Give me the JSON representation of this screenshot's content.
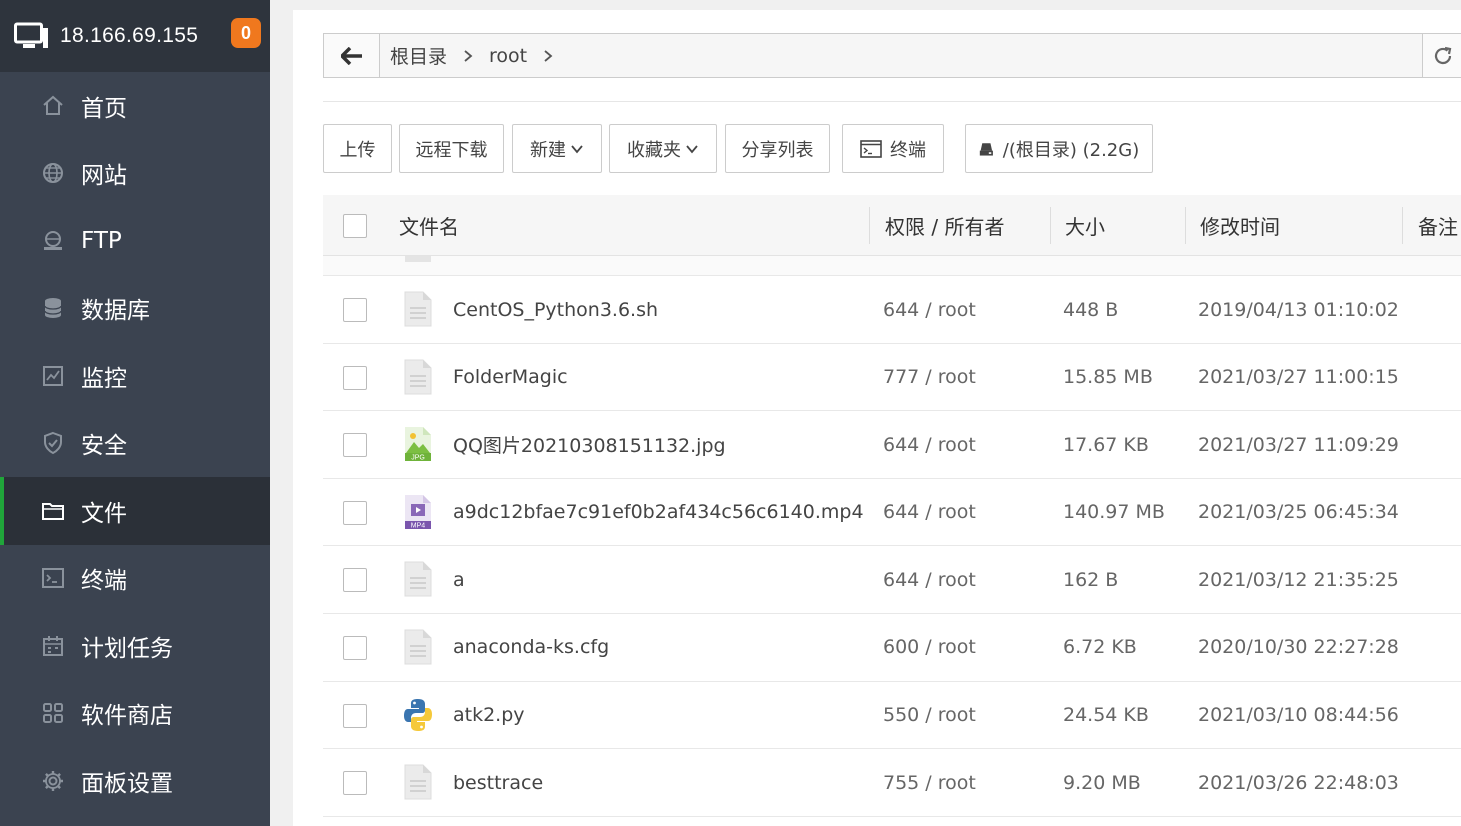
{
  "server": {
    "ip": "18.166.69.155",
    "badge": "0"
  },
  "nav": [
    {
      "label": "首页",
      "icon": "home-icon"
    },
    {
      "label": "网站",
      "icon": "globe-icon"
    },
    {
      "label": "FTP",
      "icon": "ftp-icon"
    },
    {
      "label": "数据库",
      "icon": "database-icon"
    },
    {
      "label": "监控",
      "icon": "monitor-chart-icon"
    },
    {
      "label": "安全",
      "icon": "shield-icon"
    },
    {
      "label": "文件",
      "icon": "folder-icon",
      "active": true
    },
    {
      "label": "终端",
      "icon": "terminal-icon"
    },
    {
      "label": "计划任务",
      "icon": "calendar-icon"
    },
    {
      "label": "软件商店",
      "icon": "apps-grid-icon"
    },
    {
      "label": "面板设置",
      "icon": "gear-icon"
    }
  ],
  "path": {
    "crumbs": [
      "根目录",
      "root"
    ]
  },
  "toolbar": {
    "upload": "上传",
    "remote_download": "远程下载",
    "new": "新建",
    "favorites": "收藏夹",
    "share_list": "分享列表",
    "terminal": "终端",
    "disk": "/(根目录) (2.2G)"
  },
  "table": {
    "headers": {
      "name": "文件名",
      "perm": "权限 / 所有者",
      "size": "大小",
      "mtime": "修改时间",
      "note": "备注"
    },
    "rows": [
      {
        "name": "CentOS_Python3.6.sh",
        "perm": "644 / root",
        "size": "448 B",
        "mtime": "2019/04/13 01:10:02",
        "icon": "file-icon"
      },
      {
        "name": "FolderMagic",
        "perm": "777 / root",
        "size": "15.85 MB",
        "mtime": "2021/03/27 11:00:15",
        "icon": "file-icon"
      },
      {
        "name": "QQ图片20210308151132.jpg",
        "perm": "644 / root",
        "size": "17.67 KB",
        "mtime": "2021/03/27 11:09:29",
        "icon": "jpg-file-icon",
        "icon_text": "JPG"
      },
      {
        "name": "a9dc12bfae7c91ef0b2af434c56c6140.mp4",
        "perm": "644 / root",
        "size": "140.97 MB",
        "mtime": "2021/03/25 06:45:34",
        "icon": "mp4-file-icon",
        "icon_text": "MP4"
      },
      {
        "name": "a",
        "perm": "644 / root",
        "size": "162 B",
        "mtime": "2021/03/12 21:35:25",
        "icon": "file-icon"
      },
      {
        "name": "anaconda-ks.cfg",
        "perm": "600 / root",
        "size": "6.72 KB",
        "mtime": "2020/10/30 22:27:28",
        "icon": "file-icon"
      },
      {
        "name": "atk2.py",
        "perm": "550 / root",
        "size": "24.54 KB",
        "mtime": "2021/03/10 08:44:56",
        "icon": "python-file-icon"
      },
      {
        "name": "besttrace",
        "perm": "755 / root",
        "size": "9.20 MB",
        "mtime": "2021/03/26 22:48:03",
        "icon": "file-icon"
      }
    ]
  }
}
